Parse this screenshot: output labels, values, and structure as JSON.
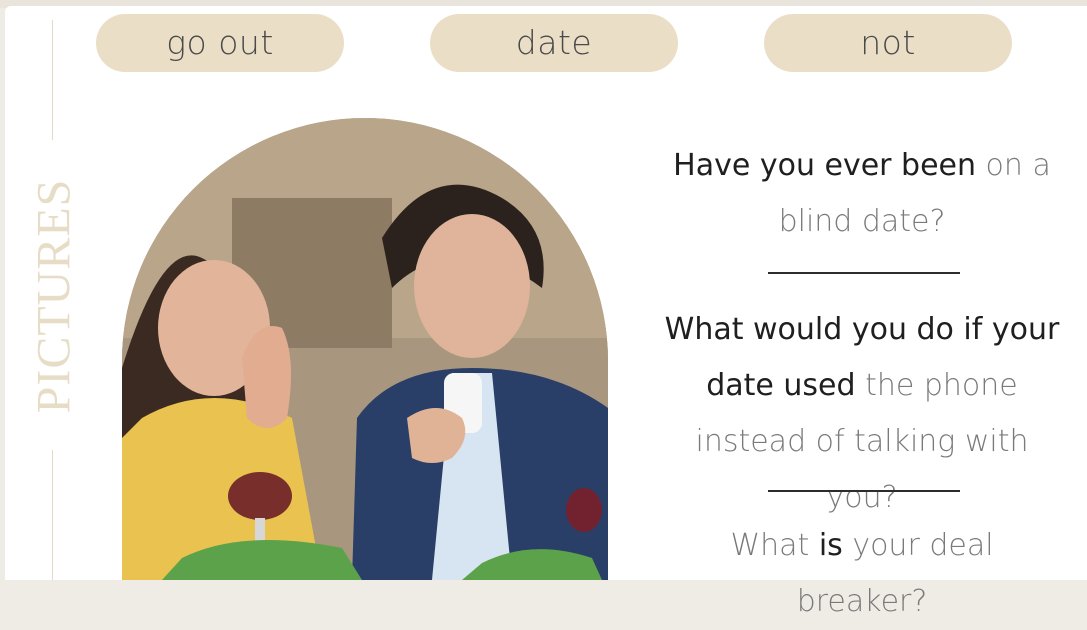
{
  "pills": [
    "go out",
    "date",
    "not"
  ],
  "side_label": "PICTURES",
  "questions": {
    "q1": {
      "dark": "Have you ever been",
      "light": "on a blind date?"
    },
    "q2": {
      "dark_a": "What would you do if your",
      "dark_b": "date used",
      "light": "the phone instead of talking with you?"
    },
    "q3": {
      "light_a": "What",
      "dark": "is",
      "light_b": "your deal breaker?"
    }
  },
  "photo": {
    "alt": "A woman looks bored at a restaurant table while a man looks at his phone."
  },
  "colors": {
    "pill_bg": "#eadfc6",
    "pill_text": "#4a4a4a",
    "side_label": "#e7dcc5",
    "dark_text": "#1f1f1f",
    "light_text": "#7a7a7a",
    "rule": "#2c2c2c"
  }
}
